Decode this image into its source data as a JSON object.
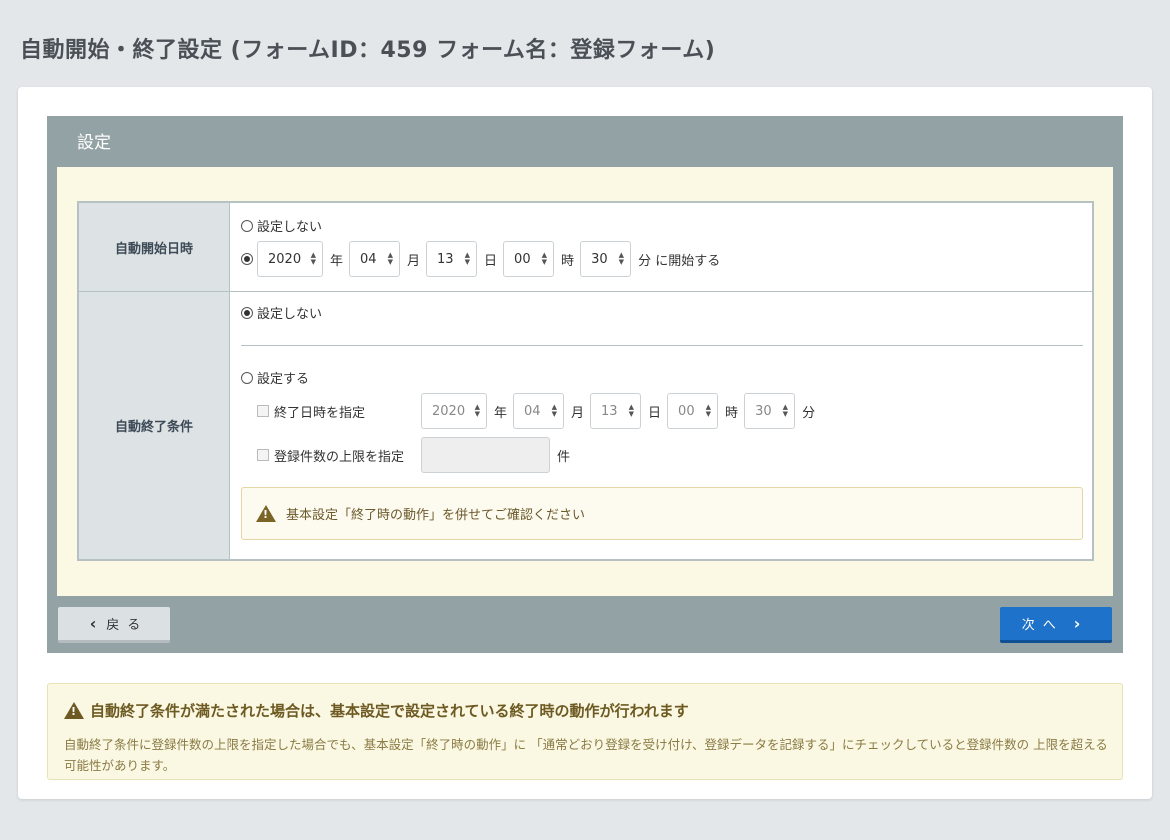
{
  "page_title": "自動開始・終了設定 (フォームID：459 フォーム名：登録フォーム)",
  "panel": {
    "title": "設定",
    "auto_start": {
      "label": "自動開始日時",
      "option_none": "設定しない",
      "year": "2020",
      "month": "04",
      "day": "13",
      "hour": "00",
      "minute": "30",
      "unit_year": "年",
      "unit_month": "月",
      "unit_day": "日",
      "unit_hour": "時",
      "unit_minute_suffix": "分 に開始する",
      "selected": "date"
    },
    "auto_end": {
      "label": "自動終了条件",
      "option_none": "設定しない",
      "option_set": "設定する",
      "selected": "none",
      "end_date_label": "終了日時を指定",
      "year": "2020",
      "month": "04",
      "day": "13",
      "hour": "00",
      "minute": "30",
      "unit_year": "年",
      "unit_month": "月",
      "unit_day": "日",
      "unit_hour": "時",
      "unit_minute": "分",
      "limit_label": "登録件数の上限を指定",
      "limit_value": "",
      "limit_unit": "件",
      "warning": "基本設定「終了時の動作」を併せてご確認ください"
    },
    "back_button": "戻る",
    "next_button": "次へ"
  },
  "notice": {
    "title": "自動終了条件が満たされた場合は、基本設定で設定されている終了時の動作が行われます",
    "text": "自動終了条件に登録件数の上限を指定した場合でも、基本設定「終了時の動作」に 「通常どおり登録を受け付け、登録データを記録する」にチェックしていると登録件数の 上限を超える可能性があります。"
  },
  "colors": {
    "panel_header": "#93a3a5",
    "panel_body": "#fbf8e3",
    "next_button": "#1f72c9",
    "notice_bg": "#faf8e2"
  }
}
